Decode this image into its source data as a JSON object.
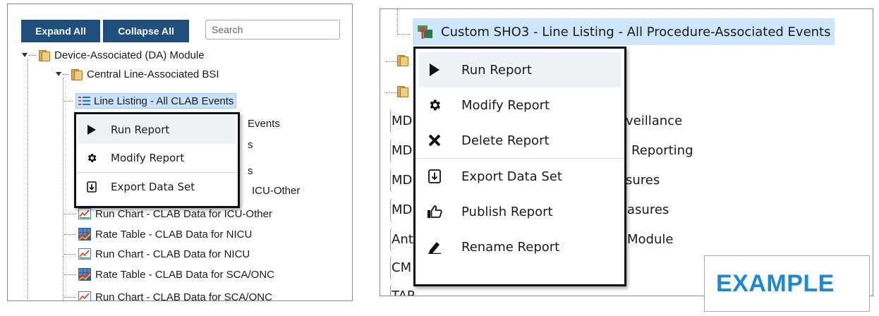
{
  "left_panel": {
    "expand_all_label": "Expand All",
    "collapse_all_label": "Collapse All",
    "search_placeholder": "Search",
    "tree": [
      {
        "label": "Device-Associated (DA) Module"
      },
      {
        "label": "Central Line-Associated BSI"
      },
      {
        "label": "Line Listing - All CLAB Events"
      },
      {
        "label": "Events"
      },
      {
        "label": "s"
      },
      {
        "label": "s"
      },
      {
        "label": "ICU-Other"
      },
      {
        "label": "Run Chart - CLAB Data for ICU-Other"
      },
      {
        "label": "Rate Table - CLAB Data for NICU"
      },
      {
        "label": "Run Chart - CLAB Data for NICU"
      },
      {
        "label": "Rate Table - CLAB Data for SCA/ONC"
      },
      {
        "label": "Run Chart - CLAB Data for SCA/ONC"
      }
    ],
    "context_menu": [
      {
        "label": "Run Report",
        "icon": "play-icon"
      },
      {
        "label": "Modify Report",
        "icon": "gear-icon"
      },
      {
        "label": "Export Data Set",
        "icon": "export-icon"
      }
    ]
  },
  "right_panel": {
    "selected_item": "Custom SHO3 - Line Listing - All Procedure-Associated Events",
    "rows": [
      {
        "prefix": "MD",
        "suffix": "veillance"
      },
      {
        "prefix": "MD",
        "suffix": "Reporting"
      },
      {
        "prefix": "MD",
        "suffix": "sures"
      },
      {
        "prefix": "MD",
        "suffix": "asures"
      },
      {
        "prefix": "Ant",
        "suffix": "Module"
      },
      {
        "prefix": "CM",
        "suffix": ""
      },
      {
        "prefix": "TAP",
        "suffix": ""
      }
    ],
    "context_menu": [
      {
        "label": "Run Report",
        "icon": "play-icon"
      },
      {
        "label": "Modify Report",
        "icon": "gear-icon"
      },
      {
        "label": "Delete Report",
        "icon": "delete-x-icon"
      },
      {
        "label": "Export Data Set",
        "icon": "export-icon"
      },
      {
        "label": "Publish Report",
        "icon": "thumbs-up-icon"
      },
      {
        "label": "Rename Report",
        "icon": "pencil-icon"
      }
    ]
  },
  "example_label": "EXAMPLE",
  "colors": {
    "button_bg": "#1f4f7c",
    "selection_bg": "#c8e3fb",
    "example_text": "#1e88d6"
  }
}
